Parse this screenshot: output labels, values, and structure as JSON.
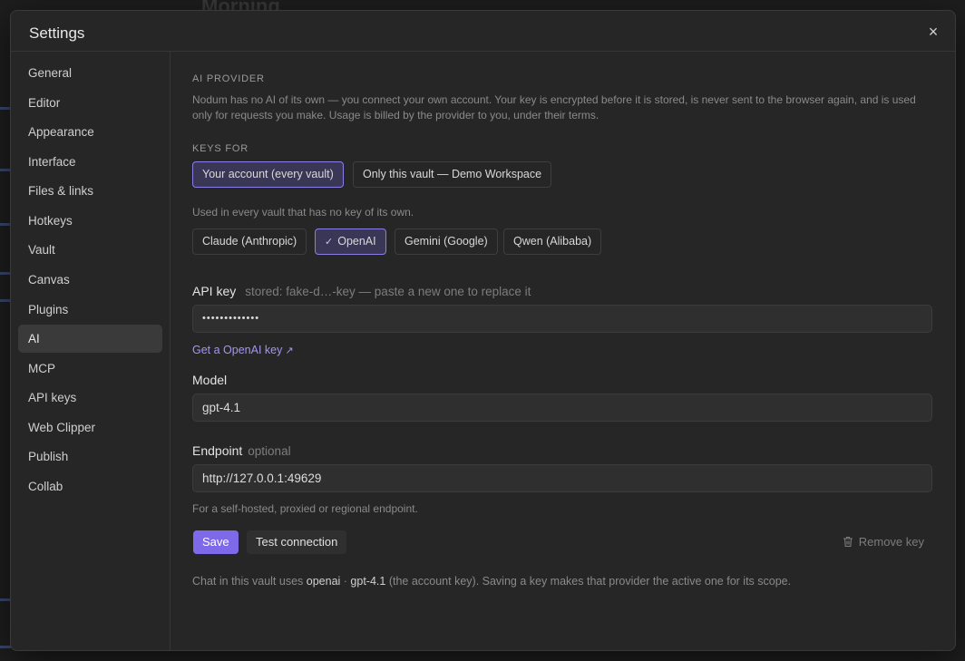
{
  "background": {
    "title": "Morning"
  },
  "modal": {
    "title": "Settings",
    "close_icon": "×"
  },
  "sidebar": {
    "items": [
      {
        "label": "General"
      },
      {
        "label": "Editor"
      },
      {
        "label": "Appearance"
      },
      {
        "label": "Interface"
      },
      {
        "label": "Files & links"
      },
      {
        "label": "Hotkeys"
      },
      {
        "label": "Vault"
      },
      {
        "label": "Canvas"
      },
      {
        "label": "Plugins"
      },
      {
        "label": "AI"
      },
      {
        "label": "MCP"
      },
      {
        "label": "API keys"
      },
      {
        "label": "Web Clipper"
      },
      {
        "label": "Publish"
      },
      {
        "label": "Collab"
      }
    ],
    "active": "AI"
  },
  "ai": {
    "section_title": "AI PROVIDER",
    "description": "Nodum has no AI of its own — you connect your own account. Your key is encrypted before it is stored, is never sent to the browser again, and is used only for requests you make. Usage is billed by the provider to you, under their terms.",
    "keys_for_label": "KEYS FOR",
    "scope_options": [
      {
        "label": "Your account (every vault)",
        "active": true
      },
      {
        "label": "Only this vault — Demo Workspace",
        "active": false
      }
    ],
    "scope_help": "Used in every vault that has no key of its own.",
    "providers": [
      {
        "label": "Claude (Anthropic)",
        "active": false
      },
      {
        "label": "OpenAI",
        "active": true
      },
      {
        "label": "Gemini (Google)",
        "active": false
      },
      {
        "label": "Qwen (Alibaba)",
        "active": false
      }
    ],
    "check_icon": "✓",
    "api_key": {
      "label": "API key",
      "hint": "stored: fake-d…-key — paste a new one to replace it",
      "value": "•••••••••••••",
      "link": "Get a OpenAI key",
      "link_icon": "↗"
    },
    "model": {
      "label": "Model",
      "value": "gpt-4.1"
    },
    "endpoint": {
      "label": "Endpoint",
      "hint": "optional",
      "value": "http://127.0.0.1:49629",
      "help": "For a self-hosted, proxied or regional endpoint."
    },
    "buttons": {
      "save": "Save",
      "test": "Test connection",
      "remove": "Remove key",
      "remove_icon": "trash-icon"
    },
    "footnote": {
      "prefix": "Chat in this vault uses ",
      "provider": "openai",
      "sep": " · ",
      "model": "gpt-4.1",
      "suffix": " (the account key). Saving a key makes that provider the active one for its scope."
    }
  },
  "colors": {
    "accent": "#7e6ae8",
    "link": "#a593f5",
    "active_seg_border": "#8a7fe6"
  }
}
